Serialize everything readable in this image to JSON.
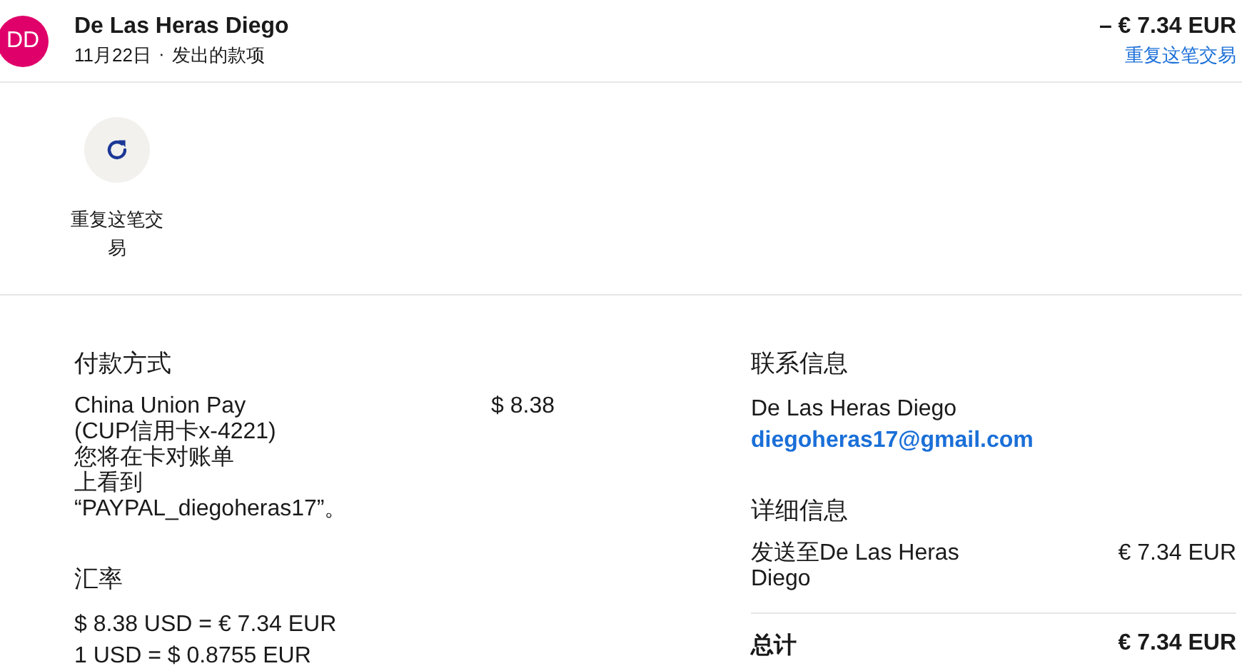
{
  "header": {
    "avatar": "DD",
    "name": "De Las Heras Diego",
    "date": "11月22日",
    "separator": "·",
    "type": "发出的款项",
    "amount": "– € 7.34 EUR",
    "repeat_link": "重复这笔交易"
  },
  "actions": [
    {
      "label": "重复这笔交易"
    }
  ],
  "payment": {
    "title": "付款方式",
    "method_lines": [
      "China Union Pay",
      "(CUP信用卡x-4221)",
      "您将在卡对账单",
      "上看到",
      "“PAYPAL_diegoheras17”。"
    ],
    "amount": "$ 8.38"
  },
  "exchange": {
    "title": "汇率",
    "lines": [
      "$ 8.38 USD = € 7.34 EUR",
      "1 USD = $ 0.8755 EUR"
    ]
  },
  "contact": {
    "title": "联系信息",
    "name": "De Las Heras Diego",
    "email": "diegoheras17@gmail.com"
  },
  "details": {
    "title": "详细信息",
    "rows": [
      {
        "label": "发送至De Las Heras\nDiego",
        "value": "€ 7.34 EUR"
      }
    ],
    "total_label": "总计",
    "total_value": "€ 7.34 EUR"
  }
}
